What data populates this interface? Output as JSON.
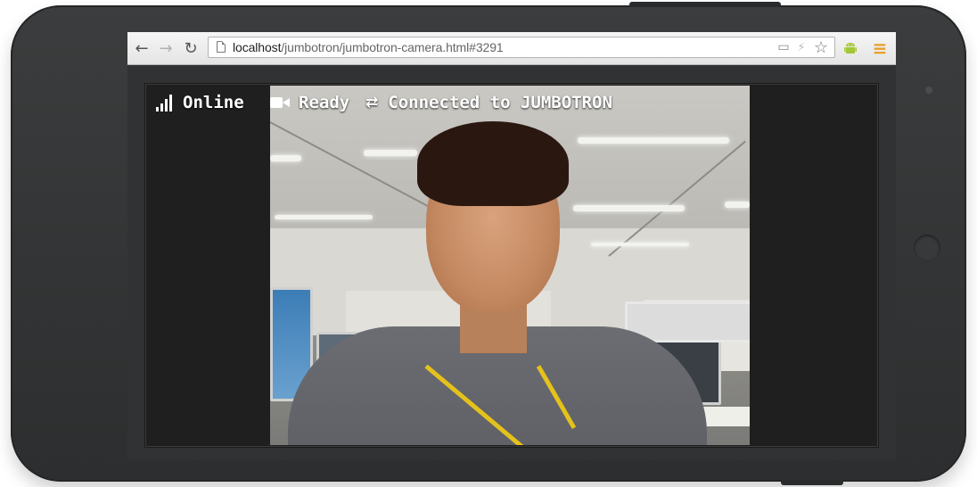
{
  "browser": {
    "url_host": "localhost",
    "url_path": "/jumbotron/jumbotron-camera.html#3291",
    "nav": {
      "back_icon": "←",
      "forward_icon": "→",
      "reload_icon": "↻"
    },
    "omnibox_icons": {
      "camera_icon": "▭",
      "flash_icon": "⚡",
      "star_icon": "☆"
    },
    "extensions": {
      "android_icon": "android-icon",
      "menu_icon": "≡"
    },
    "colors": {
      "android": "#a4c639",
      "menu": "#e8a02a"
    }
  },
  "status": {
    "network_label": "Online",
    "camera_label": "Ready",
    "connection_label": "Connected to JUMBOTRON",
    "swap_icon": "⇄"
  }
}
